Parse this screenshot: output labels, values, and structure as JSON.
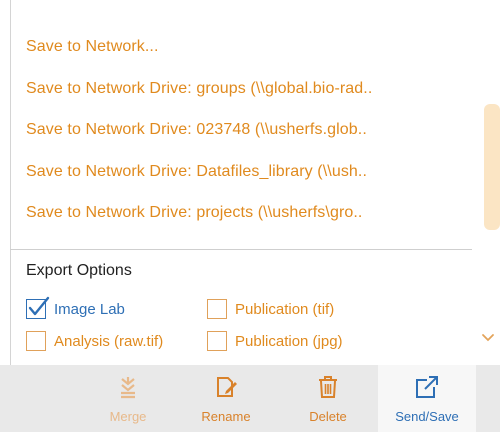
{
  "save_menu": {
    "items": [
      {
        "label": "Save to Network..."
      },
      {
        "label": "Save to Network Drive: groups (\\\\global.bio-rad.."
      },
      {
        "label": "Save to Network Drive: 023748 (\\\\usherfs.glob.."
      },
      {
        "label": "Save to Network Drive: Datafiles_library (\\\\ush.."
      },
      {
        "label": "Save to Network Drive: projects (\\\\usherfs\\gro.."
      }
    ]
  },
  "export_options": {
    "title": "Export Options",
    "options": [
      {
        "label": "Image Lab",
        "checked": true
      },
      {
        "label": "Publication (tif)",
        "checked": false
      },
      {
        "label": "Analysis (raw.tif)",
        "checked": false
      },
      {
        "label": "Publication (jpg)",
        "checked": false
      }
    ]
  },
  "toolbar": {
    "buttons": [
      {
        "label": "Merge",
        "icon": "merge-icon",
        "enabled": false
      },
      {
        "label": "Rename",
        "icon": "rename-icon",
        "enabled": true
      },
      {
        "label": "Delete",
        "icon": "trash-icon",
        "enabled": true
      },
      {
        "label": "Send/Save",
        "icon": "send-save-icon",
        "enabled": true,
        "active": true
      }
    ]
  },
  "colors": {
    "accent_orange": "#e08a1e",
    "checked_blue": "#2e6fb5",
    "toolbar_bg": "#e9e9e9"
  }
}
